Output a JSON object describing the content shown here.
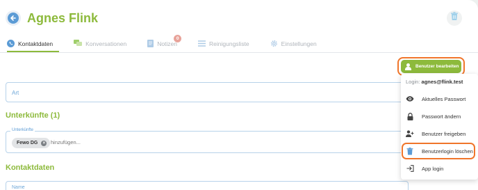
{
  "header": {
    "title": "Agnes Flink"
  },
  "tabs": [
    {
      "label": "Kontaktdaten",
      "active": true
    },
    {
      "label": "Konversationen",
      "active": false
    },
    {
      "label": "Notizen",
      "active": false,
      "badge": "0"
    },
    {
      "label": "Reinigungsliste",
      "active": false
    },
    {
      "label": "Einstellungen",
      "active": false
    }
  ],
  "actions": {
    "edit_user_label": "Benutzer bearbeiten"
  },
  "form": {
    "art_label": "Art",
    "unterkuenfte_title": "Unterkünfte (1)",
    "unterkuenfte_legend": "Unterkünfte",
    "unterkuenfte_chip": "Fewo DG",
    "unterkuenfte_placeholder": "hinzufügen...",
    "kontaktdaten_title": "Kontaktdaten",
    "name_label": "Name"
  },
  "menu": {
    "login_prefix": "Login:",
    "login_email": "agnes@flink.test",
    "items": [
      {
        "label": "Aktuelles Passwort",
        "icon": "eye-icon"
      },
      {
        "label": "Passwort ändern",
        "icon": "lock-icon"
      },
      {
        "label": "Benutzer freigeben",
        "icon": "person-add-icon"
      },
      {
        "label": "Benutzerlogin löschen",
        "icon": "trash-icon"
      },
      {
        "label": "App login",
        "icon": "login-icon"
      }
    ]
  },
  "colors": {
    "brand_green": "#8dba3c",
    "accent_blue": "#5b9bd5",
    "highlight_orange": "#f0752a",
    "badge_red": "#e8a39a"
  }
}
